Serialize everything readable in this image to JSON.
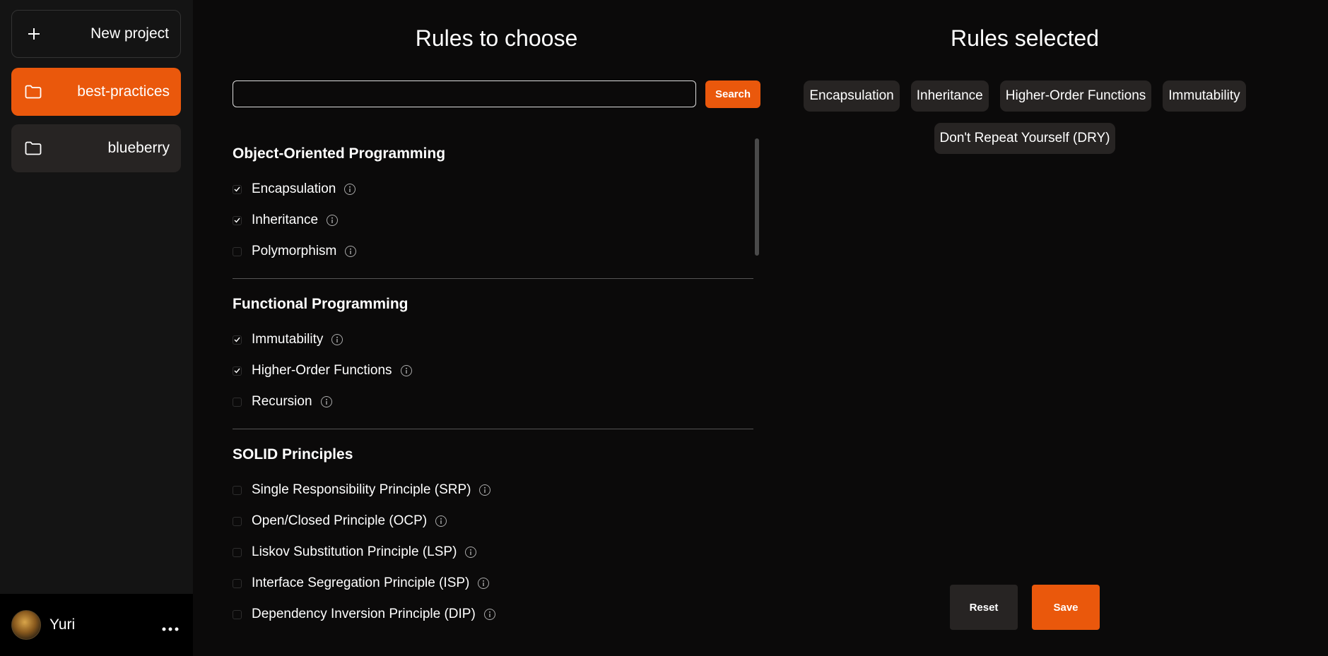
{
  "sidebar": {
    "new_project_label": "New project",
    "projects": [
      {
        "name": "best-practices",
        "active": true
      },
      {
        "name": "blueberry",
        "active": false
      }
    ],
    "user": {
      "name": "Yuri"
    }
  },
  "left": {
    "title": "Rules to choose",
    "search": {
      "value": "",
      "placeholder": "",
      "button_label": "Search"
    },
    "sections": [
      {
        "title": "Object-Oriented Programming",
        "rules": [
          {
            "label": "Encapsulation",
            "checked": true
          },
          {
            "label": "Inheritance",
            "checked": true
          },
          {
            "label": "Polymorphism",
            "checked": false
          }
        ]
      },
      {
        "title": "Functional Programming",
        "rules": [
          {
            "label": "Immutability",
            "checked": true
          },
          {
            "label": "Higher-Order Functions",
            "checked": true
          },
          {
            "label": "Recursion",
            "checked": false
          }
        ]
      },
      {
        "title": "SOLID Principles",
        "rules": [
          {
            "label": "Single Responsibility Principle (SRP)",
            "checked": false
          },
          {
            "label": "Open/Closed Principle (OCP)",
            "checked": false
          },
          {
            "label": "Liskov Substitution Principle (LSP)",
            "checked": false
          },
          {
            "label": "Interface Segregation Principle (ISP)",
            "checked": false
          },
          {
            "label": "Dependency Inversion Principle (DIP)",
            "checked": false
          }
        ]
      }
    ]
  },
  "right": {
    "title": "Rules selected",
    "selected": [
      "Encapsulation",
      "Inheritance",
      "Higher-Order Functions",
      "Immutability",
      "Don't Repeat Yourself (DRY)"
    ],
    "reset_label": "Reset",
    "save_label": "Save"
  },
  "colors": {
    "accent": "#ea580c",
    "chip_bg": "#272423",
    "background": "#0b0a0a",
    "sidebar_bg": "#141414"
  },
  "icons": {
    "new_project": "plus-icon",
    "project": "folder-icon",
    "info": "info-icon",
    "checked": "check-icon",
    "user_menu": "ellipsis-icon"
  }
}
